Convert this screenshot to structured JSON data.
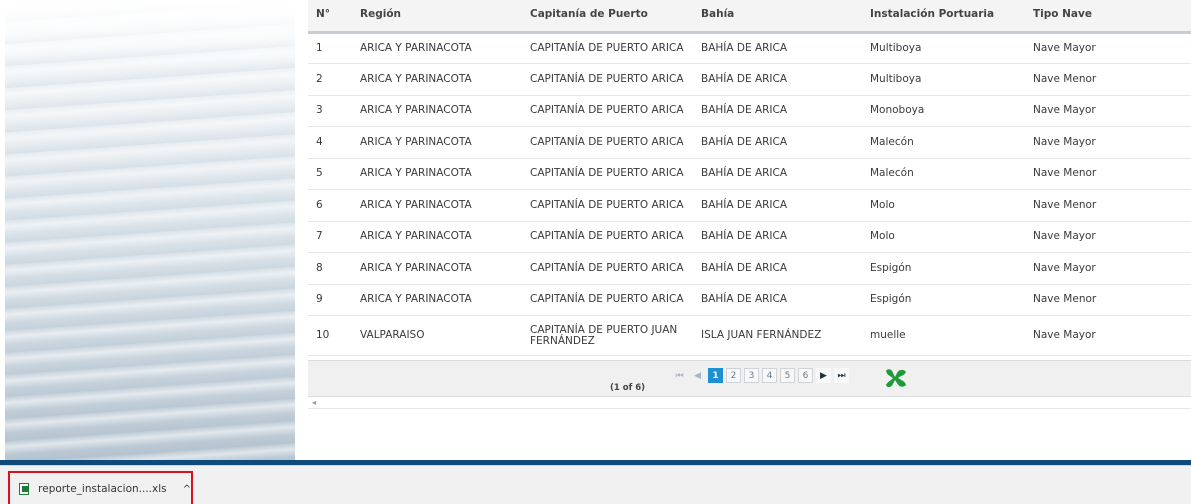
{
  "table": {
    "headers": [
      "N°",
      "Región",
      "Capitanía de Puerto",
      "Bahía",
      "Instalación Portuaria",
      "Tipo Nave"
    ],
    "rows": [
      [
        "1",
        "ARICA Y PARINACOTA",
        "CAPITANÍA DE PUERTO ARICA",
        "BAHÍA DE ARICA",
        "Multiboya",
        "Nave Mayor"
      ],
      [
        "2",
        "ARICA Y PARINACOTA",
        "CAPITANÍA DE PUERTO ARICA",
        "BAHÍA DE ARICA",
        "Multiboya",
        "Nave Menor"
      ],
      [
        "3",
        "ARICA Y PARINACOTA",
        "CAPITANÍA DE PUERTO ARICA",
        "BAHÍA DE ARICA",
        "Monoboya",
        "Nave Mayor"
      ],
      [
        "4",
        "ARICA Y PARINACOTA",
        "CAPITANÍA DE PUERTO ARICA",
        "BAHÍA DE ARICA",
        "Malecón",
        "Nave Mayor"
      ],
      [
        "5",
        "ARICA Y PARINACOTA",
        "CAPITANÍA DE PUERTO ARICA",
        "BAHÍA DE ARICA",
        "Malecón",
        "Nave Menor"
      ],
      [
        "6",
        "ARICA Y PARINACOTA",
        "CAPITANÍA DE PUERTO ARICA",
        "BAHÍA DE ARICA",
        "Molo",
        "Nave Menor"
      ],
      [
        "7",
        "ARICA Y PARINACOTA",
        "CAPITANÍA DE PUERTO ARICA",
        "BAHÍA DE ARICA",
        "Molo",
        "Nave Mayor"
      ],
      [
        "8",
        "ARICA Y PARINACOTA",
        "CAPITANÍA DE PUERTO ARICA",
        "BAHÍA DE ARICA",
        "Espigón",
        "Nave Mayor"
      ],
      [
        "9",
        "ARICA Y PARINACOTA",
        "CAPITANÍA DE PUERTO ARICA",
        "BAHÍA DE ARICA",
        "Espigón",
        "Nave Menor"
      ],
      [
        "10",
        "VALPARAISO",
        "CAPITANÍA DE PUERTO JUAN FERNÁNDEZ",
        "ISLA JUAN FERNÁNDEZ",
        "muelle",
        "Nave Mayor"
      ]
    ]
  },
  "pager": {
    "count_text": "(1 of 6)",
    "first": "⏮",
    "prev": "◀",
    "pages": [
      "1",
      "2",
      "3",
      "4",
      "5",
      "6"
    ],
    "current_page": "1",
    "next": "▶",
    "last": "⏭",
    "export_icon": "excel-export-icon"
  },
  "download": {
    "file_name": "reporte_instalacion....xls",
    "chevron": "^",
    "file_icon": "excel-file-icon"
  },
  "colors": {
    "accent": "#1d8fd3",
    "bar": "#0e4a7a",
    "highlight": "#d8121d",
    "excel_green": "#1f9a3a"
  }
}
